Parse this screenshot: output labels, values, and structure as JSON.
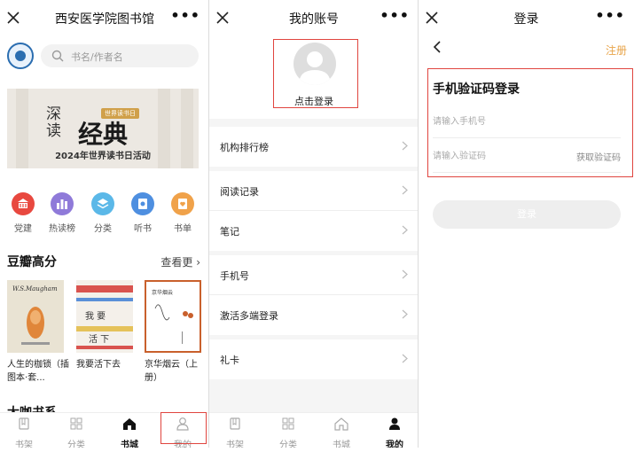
{
  "panel_home": {
    "title": "西安医学院图书馆",
    "more": "•••",
    "search_placeholder": "书名/作者名",
    "banner": {
      "deep": "深读",
      "classic": "经典",
      "tag": "世界读书日",
      "subtitle": "2024年世界读书日活动"
    },
    "categories": [
      {
        "label": "党建",
        "icon": "building-icon",
        "color": "#e8483f"
      },
      {
        "label": "热读榜",
        "icon": "chart-icon",
        "color": "#8f7ad9"
      },
      {
        "label": "分类",
        "icon": "layers-icon",
        "color": "#5bb8e8"
      },
      {
        "label": "听书",
        "icon": "headphone-icon",
        "color": "#4e8fe0"
      },
      {
        "label": "书单",
        "icon": "heart-book-icon",
        "color": "#f0a24a"
      }
    ],
    "section_title": "豆瓣高分",
    "see_more": "查看更 ›",
    "books": [
      {
        "title": "人生的枷锁（插图本·套...",
        "cover_color": "#e9e3d3"
      },
      {
        "title": "我要活下去",
        "cover_color": "#f4f0ea"
      },
      {
        "title": "京华烟云（上册）",
        "cover_color": "#ffffff"
      }
    ],
    "section2_title": "大咖书系",
    "tabs": [
      {
        "label": "书架",
        "icon": "bookshelf-icon"
      },
      {
        "label": "分类",
        "icon": "grid-icon"
      },
      {
        "label": "书城",
        "icon": "home-icon"
      },
      {
        "label": "我的",
        "icon": "user-icon"
      }
    ],
    "active_tab": 2
  },
  "panel_account": {
    "title": "我的账号",
    "more": "•••",
    "login_prompt": "点击登录",
    "menu_groups": [
      [
        "机构排行榜"
      ],
      [
        "阅读记录",
        "笔记"
      ],
      [
        "手机号",
        "激活多端登录"
      ],
      [
        "礼卡"
      ]
    ],
    "tabs": [
      {
        "label": "书架",
        "icon": "bookshelf-icon"
      },
      {
        "label": "分类",
        "icon": "grid-icon"
      },
      {
        "label": "书城",
        "icon": "home-icon"
      },
      {
        "label": "我的",
        "icon": "user-icon"
      }
    ],
    "active_tab": 3
  },
  "panel_login": {
    "title": "登录",
    "more": "•••",
    "register": "注册",
    "form_title": "手机验证码登录",
    "phone_placeholder": "请输入手机号",
    "code_placeholder": "请输入验证码",
    "get_code": "获取验证码",
    "login_button": "登录"
  },
  "colors": {
    "highlight_border": "#e0453f",
    "accent_orange": "#e8a44a"
  }
}
